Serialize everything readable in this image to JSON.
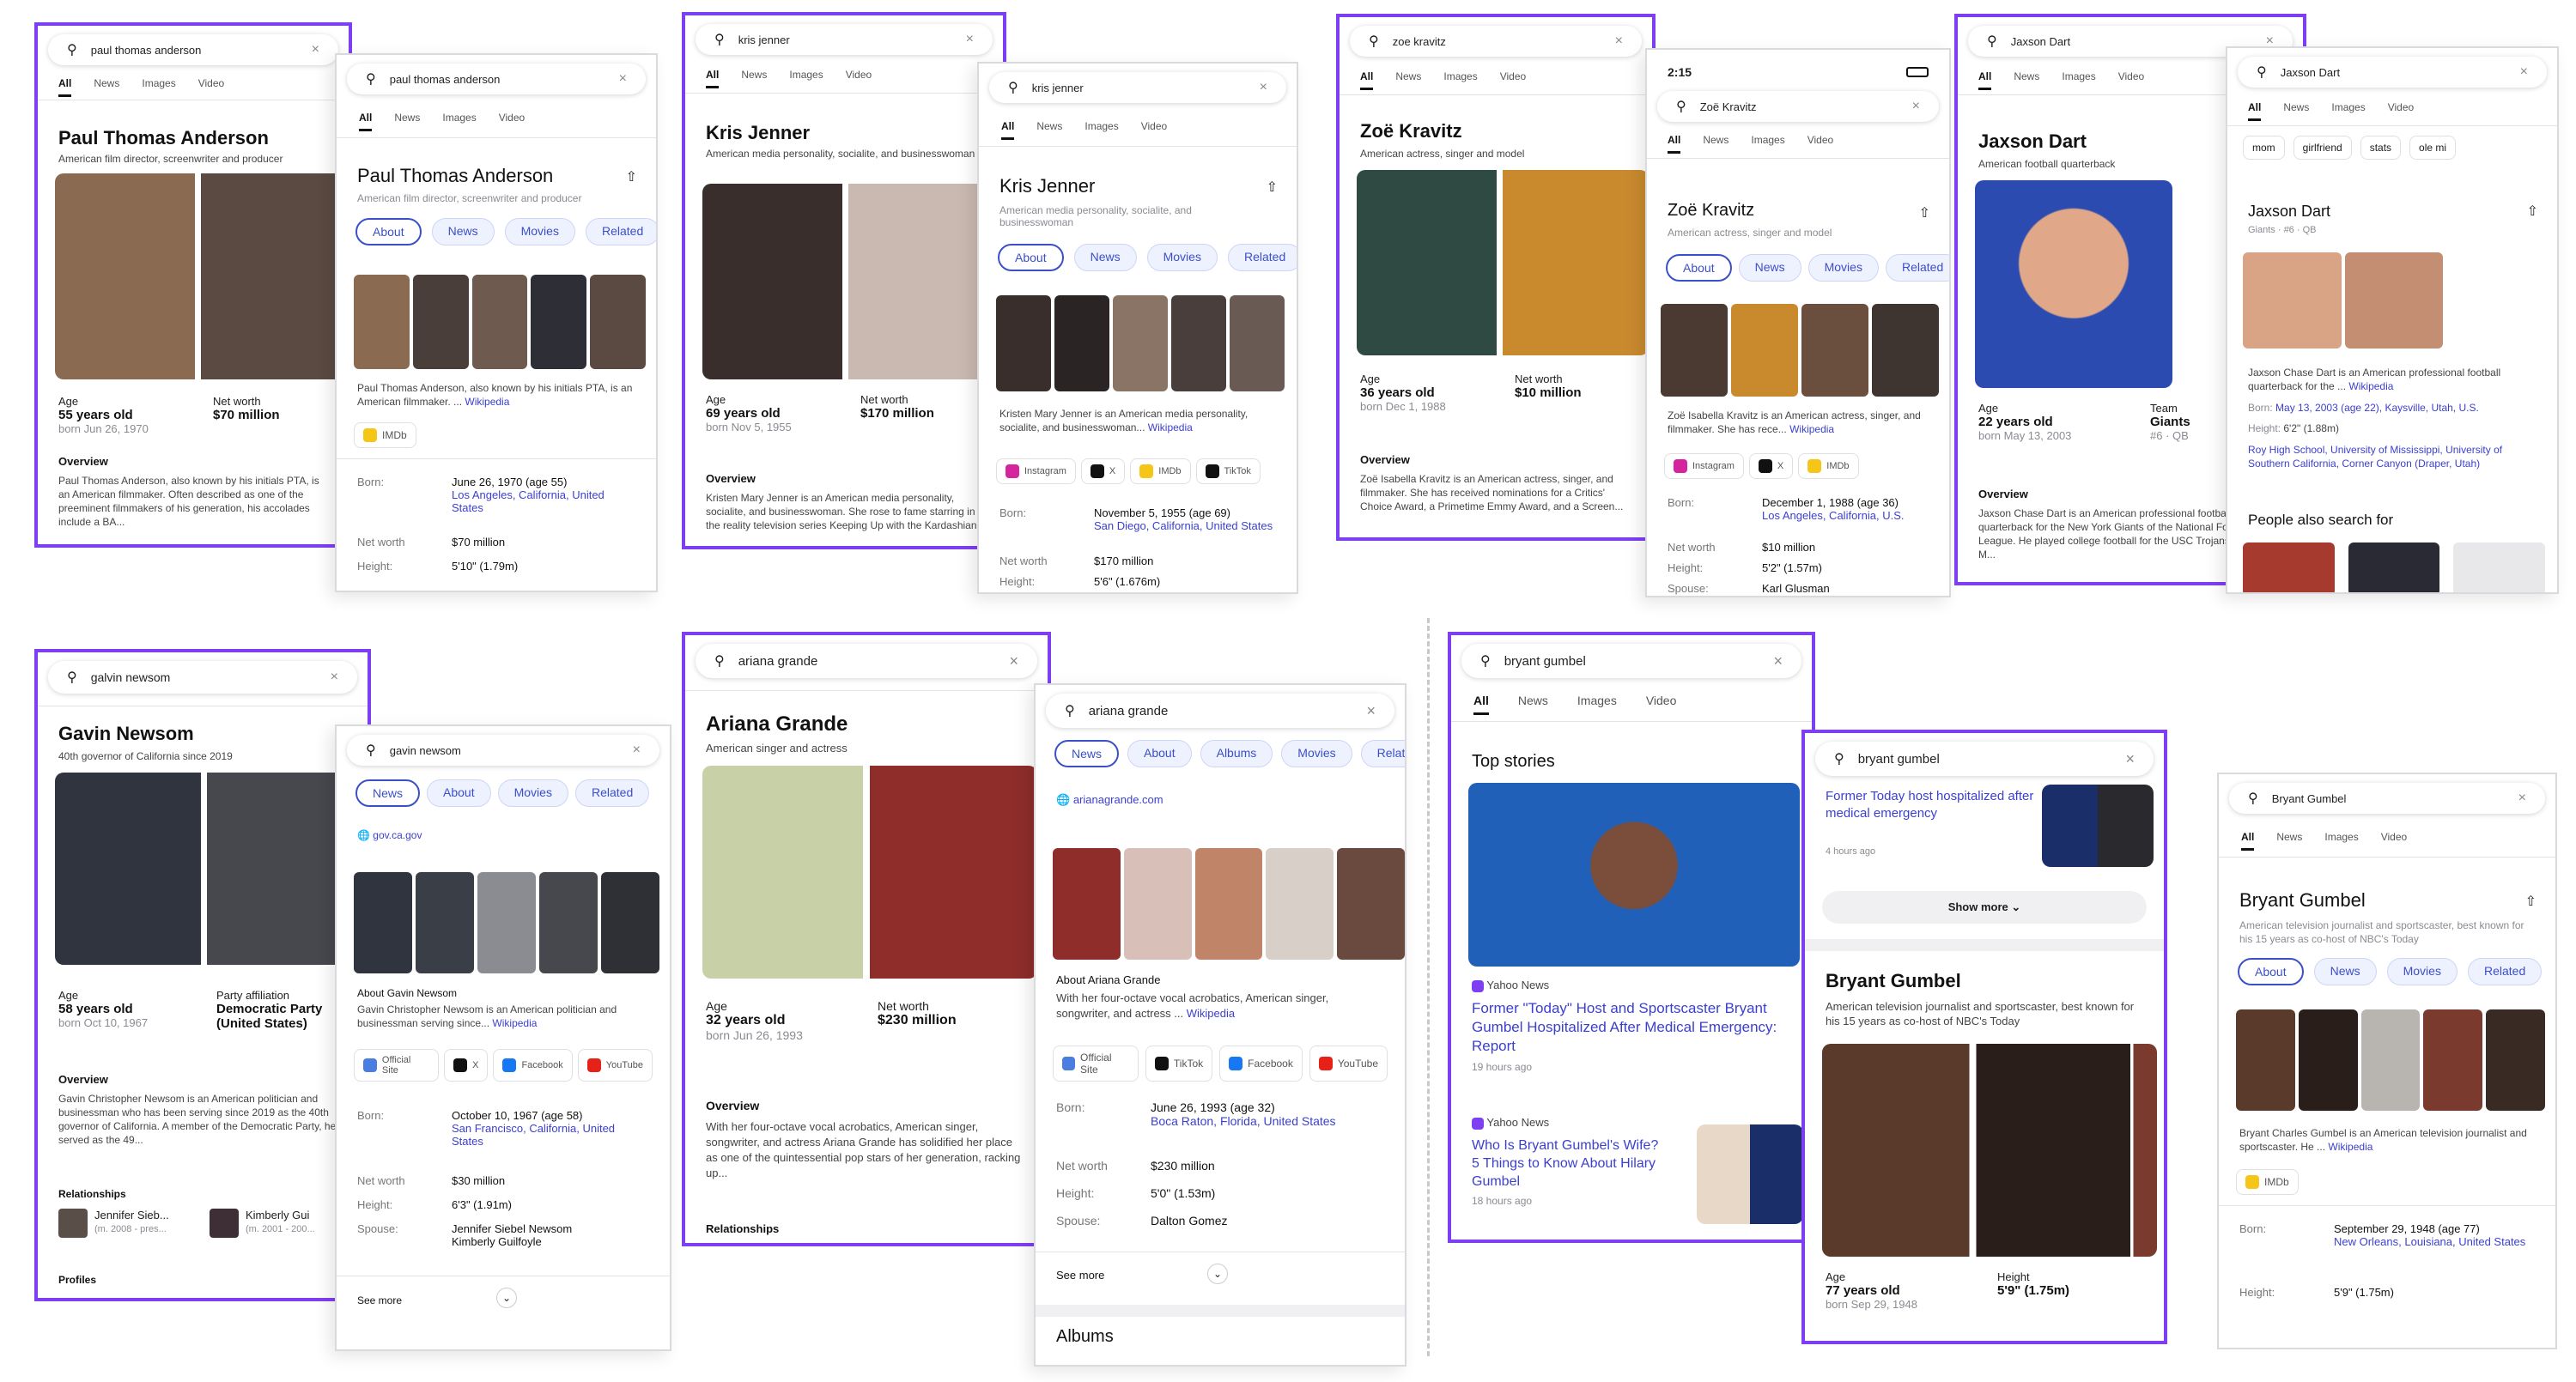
{
  "common": {
    "tab_all": "All",
    "tab_news": "News",
    "tab_images": "Images",
    "tab_video": "Video",
    "pill_about": "About",
    "pill_news": "News",
    "pill_movies": "Movies",
    "pill_related": "Related",
    "age": "Age",
    "net_worth": "Net worth",
    "overview": "Overview",
    "born": "Born:",
    "height": "Height:",
    "spouse": "Spouse:",
    "wikipedia": "Wikipedia",
    "imdb": "IMDb",
    "see_more": "See more",
    "relationships": "Relationships"
  },
  "pta": {
    "query": "paul thomas anderson",
    "name": "Paul Thomas Anderson",
    "desc": "American film director, screenwriter and producer",
    "age": "55 years old",
    "born_short": "born Jun 26, 1970",
    "worth": "$70 million",
    "overview": "Paul Thomas Anderson, also known by his initials PTA, is an American filmmaker. Often described as one of the preeminent filmmakers of his generation, his accolades include a BA...",
    "snippet": "Paul Thomas Anderson, also known by his initials PTA, is an American filmmaker. ...",
    "born": "June 26, 1970 (age 55)",
    "place": "Los Angeles, California, United States",
    "worth_row": "$70 million",
    "height": "5'10\" (1.79m)"
  },
  "kris": {
    "query": "kris jenner",
    "name": "Kris Jenner",
    "desc": "American media personality, socialite, and businesswoman",
    "age": "69 years old",
    "born_short": "born Nov 5, 1955",
    "worth": "$170 million",
    "overview": "Kristen Mary Jenner is an American media personality, socialite, and businesswoman. She rose to fame starring in the reality television series Keeping Up with the Kardashian...",
    "snippet": "Kristen Mary Jenner is an American media personality, socialite, and businesswoman...",
    "instagram": "Instagram",
    "x": "X",
    "tiktok": "TikTok",
    "born": "November 5, 1955 (age 69)",
    "place": "San Diego, California, United States",
    "worth_row": "$170 million",
    "height": "5'6\" (1.676m)"
  },
  "zoe": {
    "query": "zoe kravitz",
    "name": "Zoë Kravitz",
    "time": "2:15",
    "desc": "American actress, singer and model",
    "age": "36 years old",
    "born_short": "born Dec 1, 1988",
    "worth": "$10 million",
    "overview": "Zoë Isabella Kravitz is an American actress, singer, and filmmaker. She has received nominations for a Critics' Choice Award, a Primetime Emmy Award, and a Screen...",
    "snippet": "Zoë Isabella Kravitz is an American actress, singer, and filmmaker. She has rece...",
    "born": "December 1, 1988 (age 36)",
    "place": "Los Angeles, California, U.S.",
    "worth_row": "$10 million",
    "height": "5'2\" (1.57m)",
    "spouse": "Karl Glusman"
  },
  "jax": {
    "query": "Jaxson Dart",
    "name": "Jaxson Dart",
    "desc": "American football quarterback",
    "team_label": "Team",
    "age": "22 years old",
    "born_short": "born May 13, 2003",
    "team": "Giants",
    "team_sub": "#6 · QB",
    "small_sub": "Giants · #6 · QB",
    "chips": [
      "mom",
      "girlfriend",
      "stats",
      "ole mi"
    ],
    "overview": "Jaxson Chase Dart is an American professional football quarterback for the New York Giants of the National Football League. He played college football for the USC Trojans and Ole M...",
    "snippet": "Jaxson Chase Dart is an American professional football quarterback for the ...",
    "born": "May 13, 2003 (age 22), Kaysville, Utah, U.S.",
    "height": "6'2\" (1.88m)",
    "education": "Roy High School, University of Mississippi, University of Southern California, Corner Canyon (Draper, Utah)",
    "also": "People also search for"
  },
  "gavin": {
    "query": "galvin newsom",
    "query2": "gavin newsom",
    "name": "Gavin Newsom",
    "desc": "40th governor of California since 2019",
    "age": "58 years old",
    "born_short": "born Oct 10, 1967",
    "party_label": "Party affiliation",
    "party": "Democratic Party (United States)",
    "overview": "Gavin Christopher Newsom is an American politician and businessman who has been serving since 2019 as the 40th governor of California. A member of the Democratic Party, he served as the 49...",
    "rel1": "Jennifer Sieb...",
    "rel1_sub": "(m. 2008 - pres...",
    "rel2": "Kimberly Gui",
    "rel2_sub": "(m. 2001 - 200...",
    "profiles": "Profiles",
    "site": "gov.ca.gov",
    "about_title": "About Gavin Newsom",
    "snippet": "Gavin Christopher Newsom is an American politician and businessman serving since...",
    "official": "Official Site",
    "facebook": "Facebook",
    "youtube": "YouTube",
    "born": "October 10, 1967 (age 58)",
    "place": "San Francisco, California, United States",
    "worth_row": "$30 million",
    "height": "6'3\" (1.91m)",
    "spouse": "Jennifer Siebel Newsom",
    "spouse2": "Kimberly Guilfoyle"
  },
  "ari": {
    "query": "ariana grande",
    "name": "Ariana Grande",
    "desc": "American singer and actress",
    "age": "32 years old",
    "born_short": "born Jun 26, 1993",
    "worth": "$230 million",
    "overview": "With her four-octave vocal acrobatics, American singer, songwriter, and actress Ariana Grande has solidified her place as one of the quintessential pop stars of her generation, racking up...",
    "pill_albums": "Albums",
    "site": "arianagrande.com",
    "about_title": "About Ariana Grande",
    "snippet": "With her four-octave vocal acrobatics, American singer, songwriter, and actress ...",
    "born": "June 26, 1993 (age 32)",
    "place": "Boca Raton, Florida, United States",
    "worth_row": "$230 million",
    "height": "5'0\" (1.53m)",
    "spouse": "Dalton Gomez",
    "albums": "Albums"
  },
  "bry": {
    "query": "bryant gumbel",
    "name": "Bryant Gumbel",
    "top_stories": "Top stories",
    "source": "Yahoo News",
    "story1": "Former \"Today\" Host and Sportscaster Bryant Gumbel Hospitalized After Medical Emergency: Report",
    "story1_time": "19 hours ago",
    "story2": "Who Is Bryant Gumbel's Wife? 5 Things to Know About Hilary Gumbel",
    "story2_time": "18 hours ago",
    "mid_story": "Former Today host hospitalized after medical emergency",
    "mid_time": "4 hours ago",
    "show_more": "Show more",
    "desc": "American television journalist and sportscaster, best known for his 15 years as co-host of NBC's Today",
    "age": "77 years old",
    "born_short": "born Sep 29, 1948",
    "height_label": "Height",
    "height_big": "5'9\" (1.75m)",
    "snippet": "Bryant Charles Gumbel is an American television journalist and sportscaster. He ...",
    "born": "September 29, 1948 (age 77)",
    "place": "New Orleans, Louisiana, United States",
    "height": "5'9\" (1.75m)"
  },
  "colors": {
    "accent": "#7e3ff2",
    "link": "#3b3fd0"
  }
}
